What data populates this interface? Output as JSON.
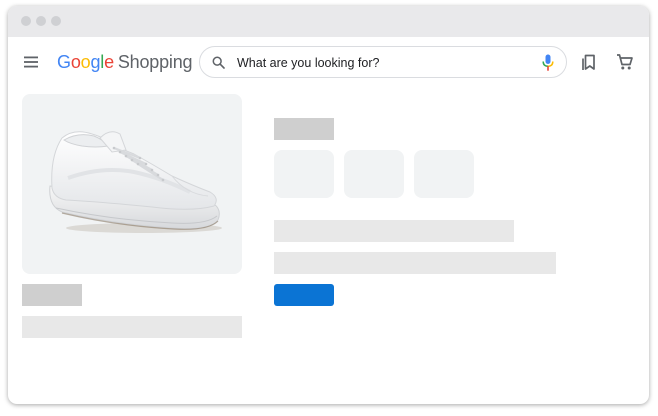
{
  "header": {
    "logo": {
      "google_letters": [
        {
          "char": "G",
          "color": "#4285f4"
        },
        {
          "char": "o",
          "color": "#ea4335"
        },
        {
          "char": "o",
          "color": "#fbbc05"
        },
        {
          "char": "g",
          "color": "#4285f4"
        },
        {
          "char": "l",
          "color": "#34a853"
        },
        {
          "char": "e",
          "color": "#ea4335"
        }
      ],
      "product": "Shopping"
    },
    "search": {
      "text": "What are you looking for?"
    },
    "icons": {
      "menu": "menu-icon",
      "search": "search-icon",
      "mic": "microphone-icon",
      "saved": "bookmarks-icon",
      "cart": "cart-icon"
    }
  },
  "product": {
    "image": "white-sneaker-image"
  },
  "colors": {
    "accent": "#0b74d4",
    "placeholder": "#e8e8e8",
    "placeholder_dark": "#cfcfcf",
    "card_bg": "#f1f3f4"
  }
}
